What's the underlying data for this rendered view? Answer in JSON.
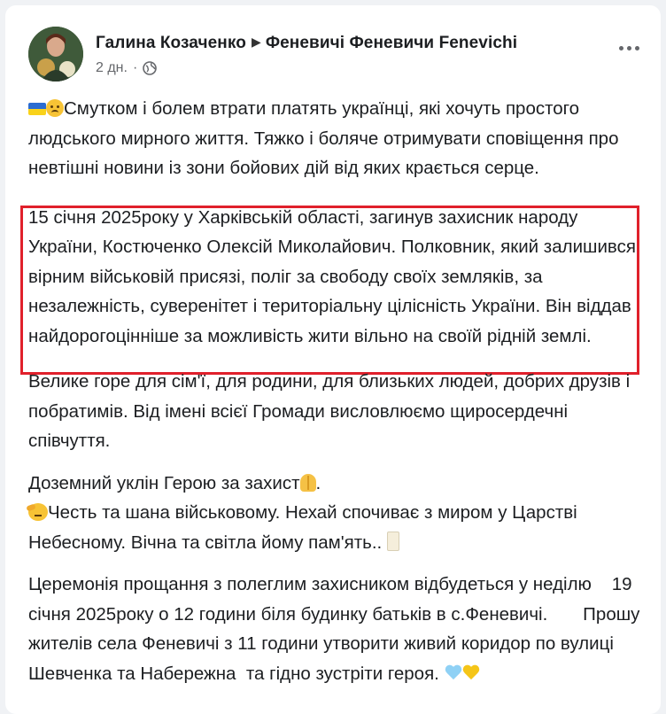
{
  "post": {
    "author": "Галина Козаченко",
    "group": "Феневичі Феневичи Fenevichi",
    "time": "2 дн.",
    "audience_icon": "globe-icon",
    "more_icon": "more-options-icon"
  },
  "body": {
    "p1": "Смутком і болем втрати платять українці, які хочуть простого людського мирного життя. Тяжко і боляче отримувати сповіщення про невтішні новини із зони бойових дій від яких крається серце.",
    "p2": "15 січня 2025року у Харківській області, загинув захисник народу України, Костюченко Олексій Миколайович. Полковник, який залишився вірним військовій присязі, поліг за свободу своїх земляків, за незалежність, суверенітет і територіальну цілісність України. Він віддав найдорогоцінніше за можливість жити вільно на своїй рідній землі.",
    "p3": "Велике горе для сім'ї, для родини, для близьких людей, добрих друзів і побратимів. Від імені всієї Громади висловлюємо щиросердечні співчуття.",
    "p4a": "Доземний уклін Герою за захист",
    "p4b": ".",
    "p4c": "Честь та шана військовому. Нехай спочиває з миром у Царстві Небесному. Вічна та світла йому пам'ять..",
    "p5": "Церемонія прощання з полеглим захисником відбудеться у неділю    19 січня 2025року о 12 години біля будинку батьків в с.Феневичі.       Прошу жителів села Феневичі з 11 години утворити живий коридор по вулиці Шевченка та Набережна  та гідно зустріти героя."
  },
  "colors": {
    "highlight_border": "#e0202b",
    "text": "#1c1e21",
    "meta": "#65676b"
  }
}
